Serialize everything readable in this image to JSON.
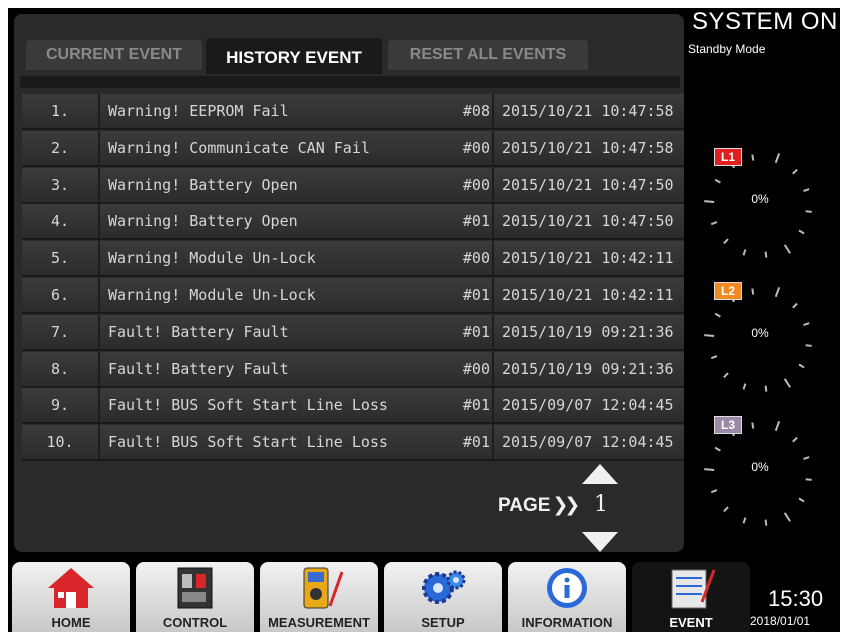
{
  "tabs": [
    {
      "label": "CURRENT EVENT",
      "active": false
    },
    {
      "label": "HISTORY EVENT",
      "active": true
    },
    {
      "label": "RESET ALL EVENTS",
      "active": false
    }
  ],
  "events": [
    {
      "num": "1.",
      "message": "Warning! EEPROM Fail",
      "code": "#08",
      "time": "2015/10/21 10:47:58"
    },
    {
      "num": "2.",
      "message": "Warning! Communicate CAN Fail",
      "code": "#00",
      "time": "2015/10/21 10:47:58"
    },
    {
      "num": "3.",
      "message": "Warning! Battery Open",
      "code": "#00",
      "time": "2015/10/21 10:47:50"
    },
    {
      "num": "4.",
      "message": "Warning! Battery Open",
      "code": "#01",
      "time": "2015/10/21 10:47:50"
    },
    {
      "num": "5.",
      "message": "Warning! Module Un-Lock",
      "code": "#00",
      "time": "2015/10/21 10:42:11"
    },
    {
      "num": "6.",
      "message": "Warning! Module Un-Lock",
      "code": "#01",
      "time": "2015/10/21 10:42:11"
    },
    {
      "num": "7.",
      "message": "Fault! Battery Fault",
      "code": "#01",
      "time": "2015/10/19 09:21:36"
    },
    {
      "num": "8.",
      "message": "Fault! Battery Fault",
      "code": "#00",
      "time": "2015/10/19 09:21:36"
    },
    {
      "num": "9.",
      "message": "Fault! BUS Soft Start Line Loss",
      "code": "#01",
      "time": "2015/09/07 12:04:45"
    },
    {
      "num": "10.",
      "message": "Fault! BUS Soft Start Line Loss",
      "code": "#01",
      "time": "2015/09/07 12:04:45"
    }
  ],
  "pager": {
    "label": "PAGE",
    "chevron": "❯❯",
    "page": "1"
  },
  "status": {
    "title": "SYSTEM ON",
    "mode": "Standby Mode"
  },
  "gauges": [
    {
      "tag": "L1",
      "value": "0%",
      "tag_color": "#e02020"
    },
    {
      "tag": "L2",
      "value": "0%",
      "tag_color": "#f08a20"
    },
    {
      "tag": "L3",
      "value": "0%",
      "tag_color": "#9a8aa8"
    }
  ],
  "nav": [
    {
      "label": "HOME",
      "icon": "home-icon"
    },
    {
      "label": "CONTROL",
      "icon": "control-panel-icon"
    },
    {
      "label": "MEASUREMENT",
      "icon": "multimeter-icon"
    },
    {
      "label": "SETUP",
      "icon": "gears-icon"
    },
    {
      "label": "INFORMATION",
      "icon": "info-icon"
    },
    {
      "label": "EVENT",
      "icon": "event-log-icon"
    }
  ],
  "clock": {
    "time": "15:30",
    "date": "2018/01/01"
  }
}
